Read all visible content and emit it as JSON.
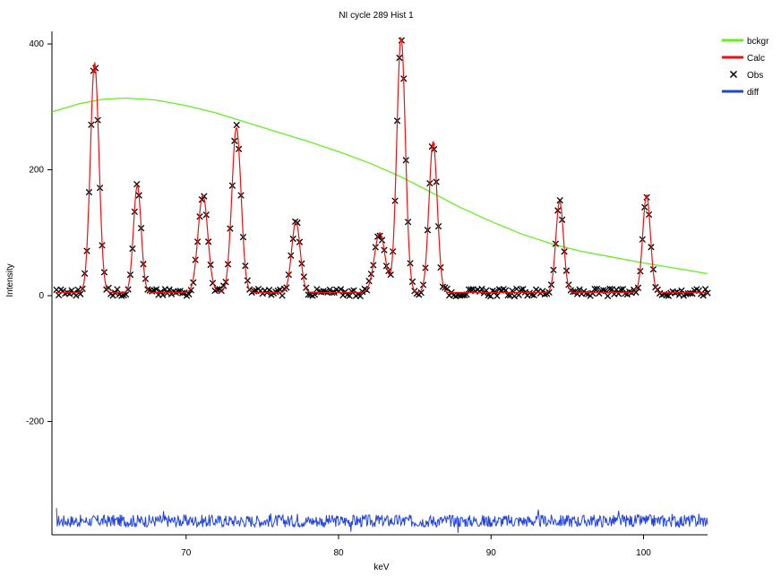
{
  "chart_data": {
    "type": "line",
    "title": "NI cycle 289 Hist 1",
    "xlabel": "keV",
    "ylabel": "Intensity",
    "xlim": [
      61.2,
      104.2
    ],
    "ylim": [
      -380,
      420
    ],
    "xticks": [
      70,
      80,
      90,
      100
    ],
    "yticks": [
      -200,
      0,
      200,
      400
    ],
    "grid": false,
    "legend_position": "top-right",
    "legend": [
      {
        "name": "bckgr",
        "kind": "line",
        "color": "#66ee22"
      },
      {
        "name": "Calc",
        "kind": "line",
        "color": "#ee1111"
      },
      {
        "name": "Obs",
        "kind": "marker",
        "color": "#000000"
      },
      {
        "name": "diff",
        "kind": "line",
        "color": "#2244dd"
      }
    ],
    "baseline": 5,
    "peaks": [
      {
        "center": 64.0,
        "height": 365,
        "width": 0.28
      },
      {
        "center": 66.8,
        "height": 170,
        "width": 0.25
      },
      {
        "center": 71.1,
        "height": 155,
        "width": 0.32
      },
      {
        "center": 73.3,
        "height": 262,
        "width": 0.3
      },
      {
        "center": 77.2,
        "height": 112,
        "width": 0.28
      },
      {
        "center": 82.7,
        "height": 95,
        "width": 0.35
      },
      {
        "center": 84.1,
        "height": 405,
        "width": 0.28
      },
      {
        "center": 86.2,
        "height": 240,
        "width": 0.27
      },
      {
        "center": 94.5,
        "height": 145,
        "width": 0.25
      },
      {
        "center": 100.2,
        "height": 155,
        "width": 0.25
      }
    ],
    "bckgr": {
      "x": [
        61.2,
        63.0,
        64.5,
        66.0,
        68.0,
        70.0,
        72.0,
        74.0,
        76.0,
        78.0,
        80.0,
        82.0,
        84.0,
        86.0,
        88.0,
        90.0,
        92.0,
        94.0,
        96.0,
        98.0,
        100.0,
        102.0,
        104.2
      ],
      "y": [
        292,
        305,
        312,
        314,
        311,
        302,
        290,
        275,
        260,
        245,
        229,
        211,
        190,
        165,
        140,
        118,
        98,
        82,
        70,
        61,
        52,
        44,
        35
      ]
    },
    "diff": {
      "offset": -358,
      "amplitude": 10
    }
  }
}
